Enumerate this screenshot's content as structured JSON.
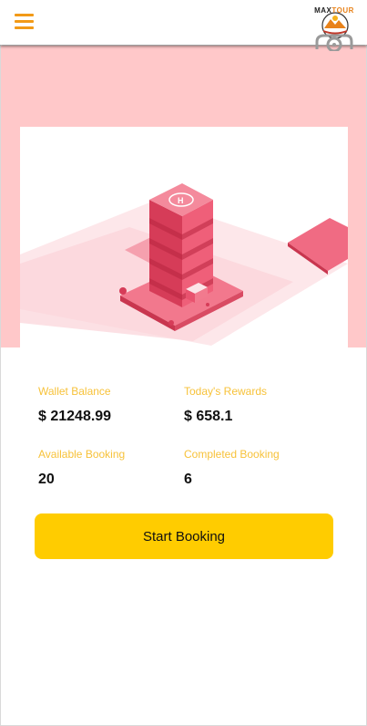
{
  "header": {
    "menu_icon": "hamburger-menu-icon",
    "menu_color": "#f29a17",
    "logo": {
      "text_plain": "MAX",
      "text_accent": "TOUR"
    }
  },
  "hero": {
    "band_color": "#ffc8c9",
    "illustration": "isometric-building-icon",
    "illustration_color": "#e8526e"
  },
  "stats": {
    "wallet_balance": {
      "label": "Wallet Balance",
      "value": "$ 21248.99"
    },
    "todays_rewards": {
      "label": "Today's Rewards",
      "value": "$ 658.1"
    },
    "available_booking": {
      "label": "Available Booking",
      "value": "20"
    },
    "completed_booking": {
      "label": "Completed Booking",
      "value": "6"
    },
    "label_color": "#f7c23a"
  },
  "actions": {
    "start_booking": {
      "label": "Start Booking",
      "color": "#ffcc00"
    }
  }
}
